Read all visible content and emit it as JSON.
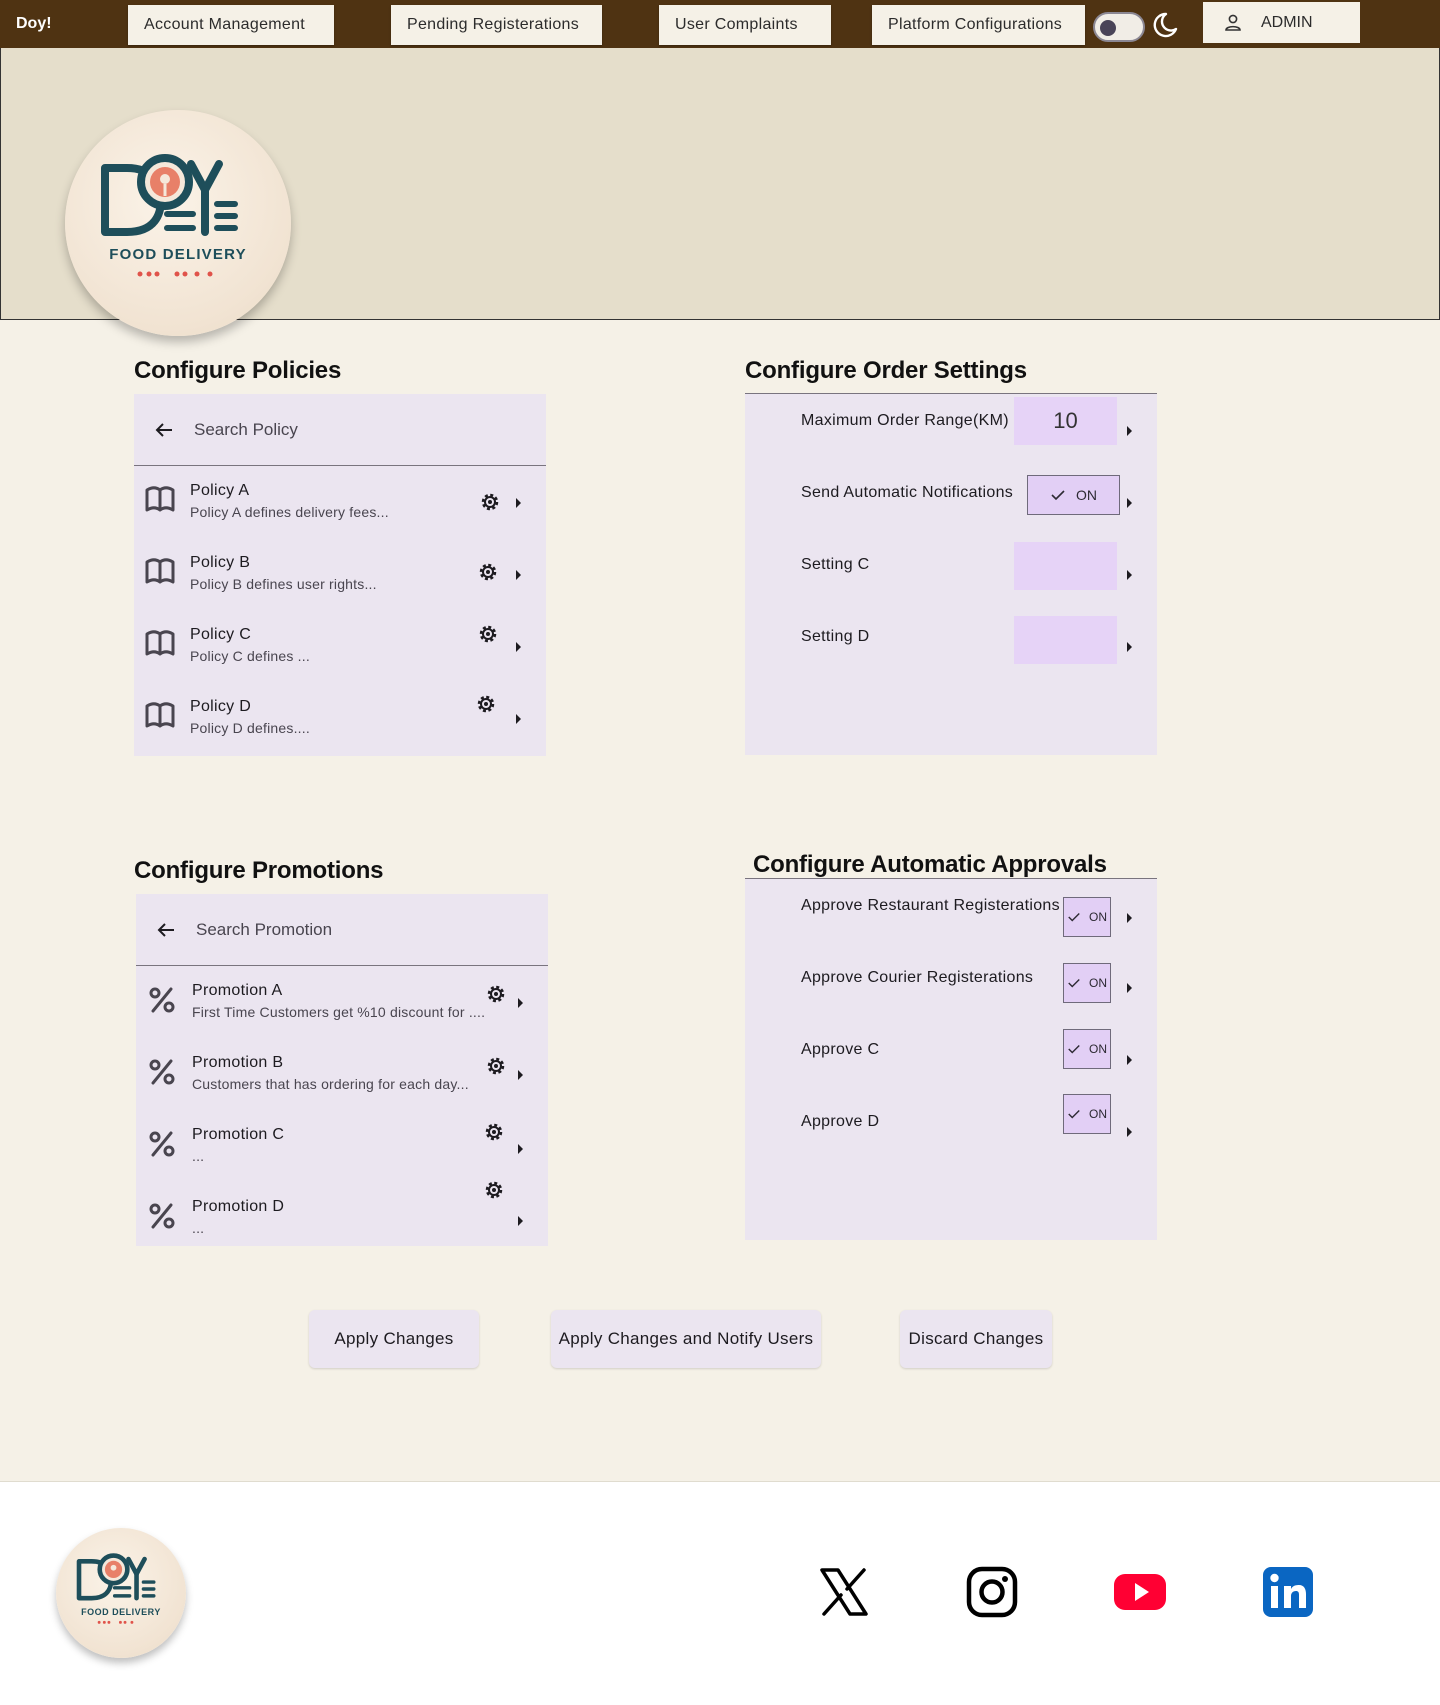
{
  "nav": {
    "brand": "Doy!",
    "tabs": [
      "Account Management",
      "Pending Registerations",
      "User Complaints",
      "Platform Configurations"
    ],
    "admin_label": "ADMIN"
  },
  "logo": {
    "text": "FOOD DELIVERY",
    "wordmark": "DOY",
    "colors": {
      "dark": "#1e4e5a",
      "accent": "#e0534a",
      "bg": "#f5e8da"
    }
  },
  "policies": {
    "title": "Configure Policies",
    "search_placeholder": "Search Policy",
    "items": [
      {
        "title": "Policy A",
        "subtitle": "Policy A defines delivery fees..."
      },
      {
        "title": "Policy B",
        "subtitle": "Policy B defines user rights..."
      },
      {
        "title": "Policy C",
        "subtitle": "Policy C defines ..."
      },
      {
        "title": "Policy D",
        "subtitle": "Policy D defines...."
      }
    ]
  },
  "order_settings": {
    "title": "Configure Order Settings",
    "items": [
      {
        "label": "Maximum Order Range(KM)",
        "value": "10"
      },
      {
        "label": "Send Automatic Notifications",
        "value": "ON"
      },
      {
        "label": "Setting C",
        "value": ""
      },
      {
        "label": "Setting D",
        "value": ""
      }
    ]
  },
  "promotions": {
    "title": "Configure Promotions",
    "search_placeholder": "Search Promotion",
    "items": [
      {
        "title": "Promotion A",
        "subtitle": "First Time Customers get %10 discount for ...."
      },
      {
        "title": "Promotion B",
        "subtitle": "Customers that has ordering for each day..."
      },
      {
        "title": "Promotion C",
        "subtitle": "..."
      },
      {
        "title": "Promotion D",
        "subtitle": "..."
      }
    ]
  },
  "approvals": {
    "title": "Configure Automatic Approvals",
    "items": [
      {
        "label": "Approve Restaurant Registerations",
        "value": "ON"
      },
      {
        "label": "Approve Courier Registerations",
        "value": "ON"
      },
      {
        "label": "Approve C",
        "value": "ON"
      },
      {
        "label": "Approve D",
        "value": "ON"
      }
    ]
  },
  "actions": {
    "apply": "Apply Changes",
    "apply_notify": "Apply Changes and Notify Users",
    "discard": "Discard Changes"
  },
  "footer": {
    "social": [
      "x-icon",
      "instagram-icon",
      "youtube-icon",
      "linkedin-icon"
    ],
    "colors": {
      "youtube": "#ff0033",
      "linkedin": "#0a66c2"
    }
  },
  "theme": {
    "nav_bg": "#4f3312",
    "header_bg": "#e5decb",
    "page_bg": "#f5f1e7",
    "panel_bg": "#ebe5f0",
    "input_bg": "#e6d3f7"
  }
}
